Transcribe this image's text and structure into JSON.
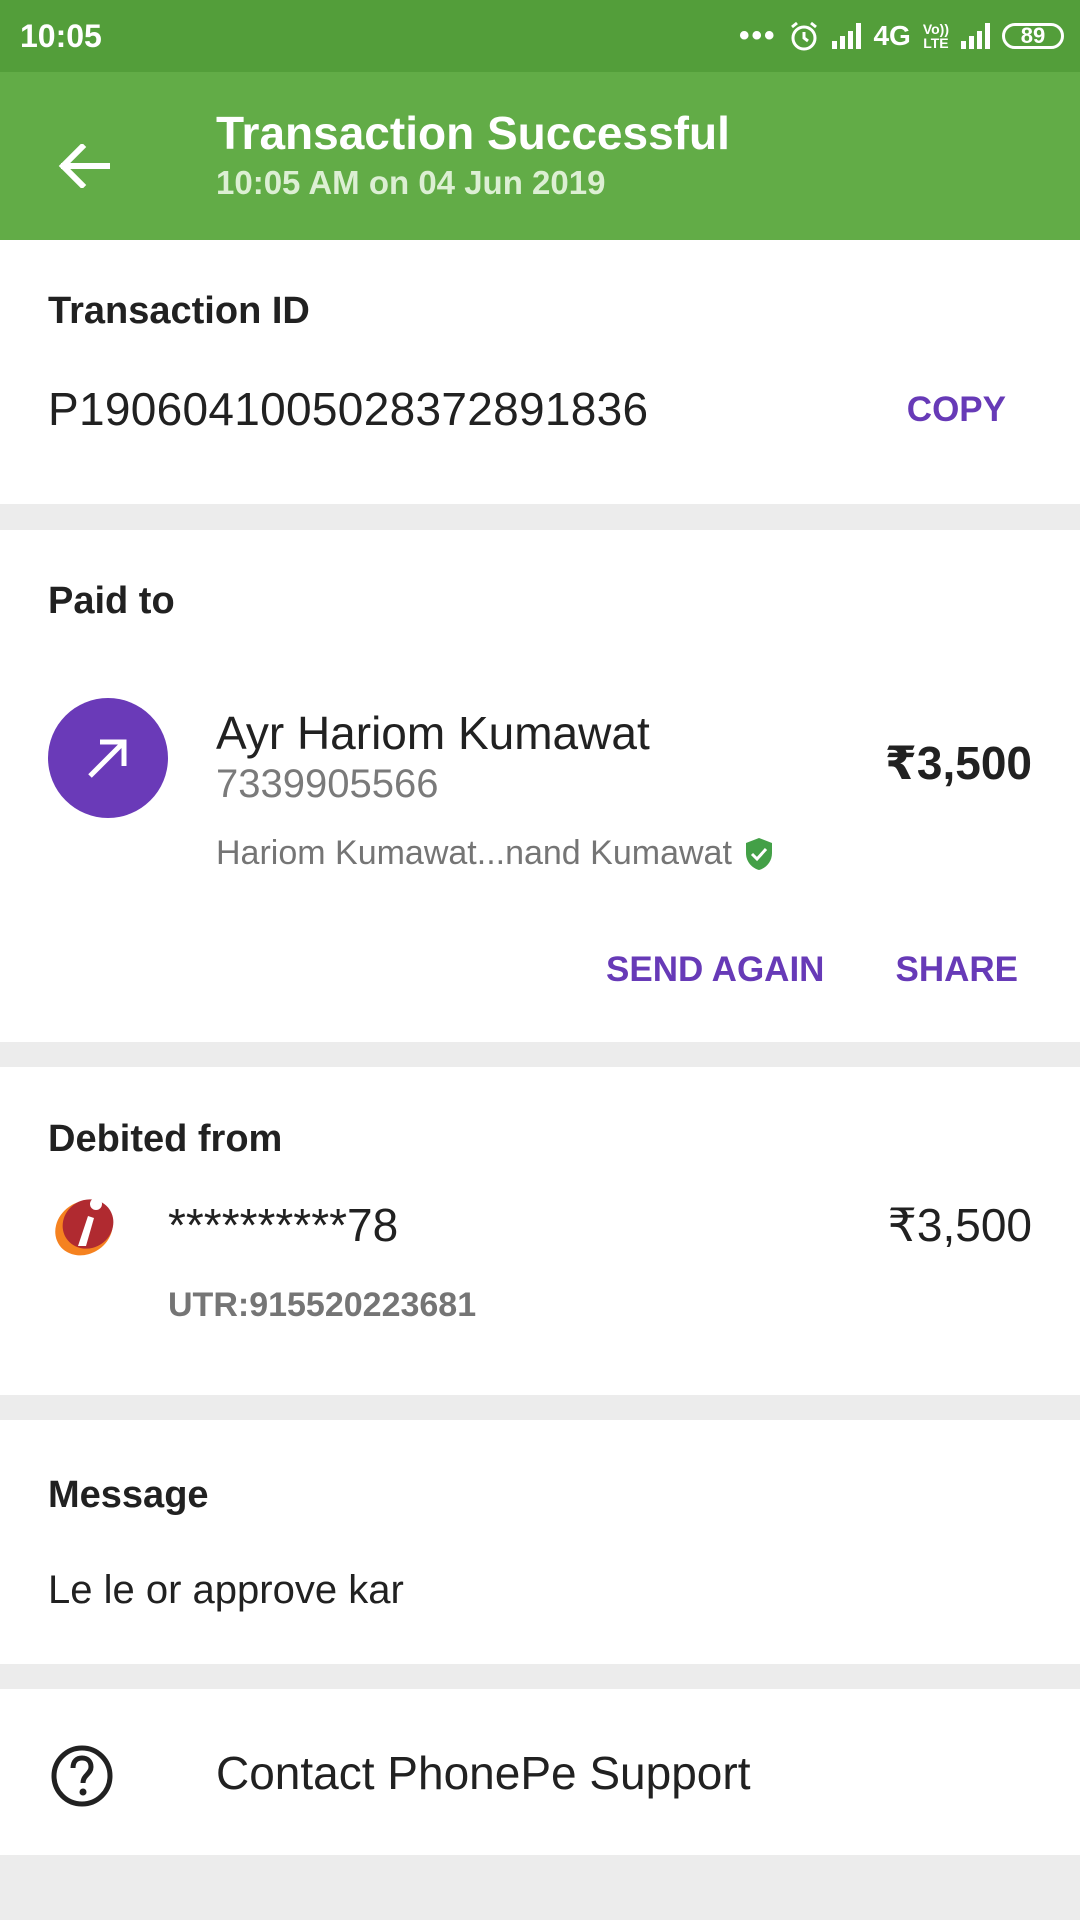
{
  "status_bar": {
    "time": "10:05",
    "network": "4G",
    "volte_top": "Vo))",
    "volte_bottom": "LTE",
    "battery": "89"
  },
  "app_bar": {
    "back_icon": "arrow-left-icon",
    "title": "Transaction Successful",
    "subtitle": "10:05 AM on 04 Jun 2019"
  },
  "transaction": {
    "label": "Transaction ID",
    "id": "P1906041005028372891836",
    "copy_label": "COPY"
  },
  "paid_to": {
    "label": "Paid to",
    "name": "Ayr Hariom Kumawat",
    "phone": "7339905566",
    "bank_name": "Hariom Kumawat...nand Kumawat",
    "verified_icon": "verified-shield-icon",
    "amount": "₹3,500",
    "send_again_label": "SEND AGAIN",
    "share_label": "SHARE"
  },
  "debited_from": {
    "label": "Debited from",
    "account": "**********78",
    "utr": "UTR:915520223681",
    "amount": "₹3,500",
    "bank_icon": "icici-bank-logo-icon"
  },
  "message": {
    "label": "Message",
    "text": "Le le  or approve kar"
  },
  "support": {
    "label": "Contact PhonePe Support",
    "icon": "help-circle-icon"
  },
  "colors": {
    "status_bar": "#539e3a",
    "app_bar": "#62ac47",
    "accent": "#673ab7",
    "verified": "#43a047"
  }
}
